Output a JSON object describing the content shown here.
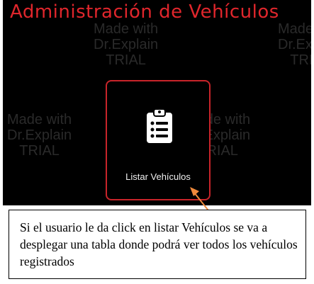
{
  "header": {
    "title": "Administración de Vehículos"
  },
  "watermark": {
    "line1": "Made with",
    "line2": "Dr.Explain",
    "line3": "TRIAL"
  },
  "card": {
    "label": "Listar Vehículos",
    "icon": "clipboard-list-icon"
  },
  "annotation": {
    "text": "Si el usuario le da click en listar Vehículos se va a desplegar una tabla donde podrá ver todos los vehículos registrados"
  },
  "colors": {
    "accent": "#e0262c",
    "background": "#000000",
    "arrow": "#f08a3c"
  }
}
